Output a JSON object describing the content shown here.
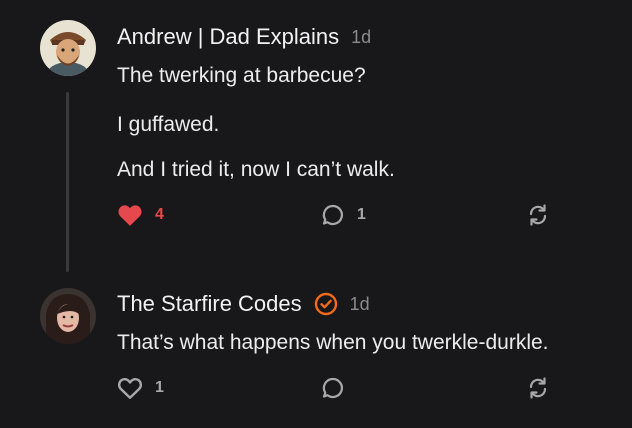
{
  "comments": [
    {
      "author": "Andrew | Dad Explains",
      "time": "1d",
      "paragraphs": [
        "The twerking at barbecue?",
        "I guffawed.",
        "And I tried it, now I can’t walk."
      ],
      "likes": "4",
      "liked": true,
      "replies": "1"
    },
    {
      "author": "The Starfire Codes",
      "time": "1d",
      "verified": true,
      "paragraphs": [
        "That’s what happens when you twerkle-durkle."
      ],
      "likes": "1",
      "liked": false,
      "replies": ""
    }
  ],
  "colors": {
    "background": "#18181a",
    "like_active": "#e5484d",
    "verified_badge": "#f26b1d",
    "muted": "#8b8b8f"
  },
  "icons": [
    "heart-icon",
    "comment-bubble-icon",
    "restack-icon",
    "verified-badge-icon"
  ]
}
